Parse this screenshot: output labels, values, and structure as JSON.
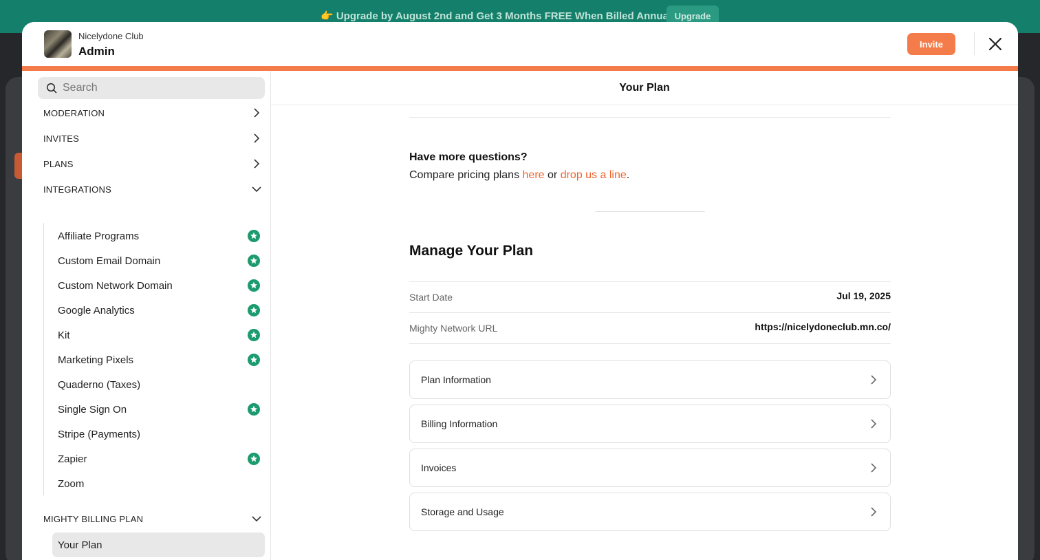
{
  "banner": {
    "text": "👉 Upgrade by August 2nd and Get 3 Months FREE When Billed Annually",
    "button": "Upgrade"
  },
  "header": {
    "org_name": "Nicelydone Club",
    "title": "Admin",
    "invite_label": "Invite"
  },
  "colors": {
    "accent": "#f47c4a",
    "link": "#f0622b",
    "star": "#1b9b6e",
    "banner": "#14806b"
  },
  "sidebar": {
    "search_placeholder": "Search",
    "sections": [
      {
        "label": "MODERATION",
        "expanded": false
      },
      {
        "label": "INVITES",
        "expanded": false
      },
      {
        "label": "PLANS",
        "expanded": false
      },
      {
        "label": "INTEGRATIONS",
        "expanded": true
      },
      {
        "label": "MIGHTY BILLING PLAN",
        "expanded": true
      }
    ],
    "integrations": [
      {
        "label": "Affiliate Programs",
        "icon": "star-badge-icon"
      },
      {
        "label": "Custom Email Domain",
        "icon": "star-badge-icon"
      },
      {
        "label": "Custom Network Domain",
        "icon": "star-badge-icon"
      },
      {
        "label": "Google Analytics",
        "icon": "star-badge-icon"
      },
      {
        "label": "Kit",
        "icon": "star-badge-icon"
      },
      {
        "label": "Marketing Pixels",
        "icon": "star-badge-icon"
      },
      {
        "label": "Quaderno (Taxes)",
        "icon": ""
      },
      {
        "label": "Single Sign On",
        "icon": "star-badge-icon"
      },
      {
        "label": "Stripe (Payments)",
        "icon": ""
      },
      {
        "label": "Zapier",
        "icon": "star-badge-icon"
      },
      {
        "label": "Zoom",
        "icon": ""
      }
    ],
    "billing_items": [
      {
        "label": "Your Plan",
        "active": true
      }
    ]
  },
  "main": {
    "title": "Your Plan",
    "questions_title": "Have more questions?",
    "questions_prefix": "Compare pricing plans ",
    "link_here": "here",
    "questions_or": " or ",
    "link_drop": "drop us a line",
    "questions_suffix": ".",
    "manage_title": "Manage Your Plan",
    "details": [
      {
        "label": "Start Date",
        "value": "Jul 19, 2025"
      },
      {
        "label": "Mighty Network URL",
        "value": "https://nicelydoneclub.mn.co/"
      }
    ],
    "cards": [
      {
        "label": "Plan Information"
      },
      {
        "label": "Billing Information"
      },
      {
        "label": "Invoices"
      },
      {
        "label": "Storage and Usage"
      }
    ]
  }
}
